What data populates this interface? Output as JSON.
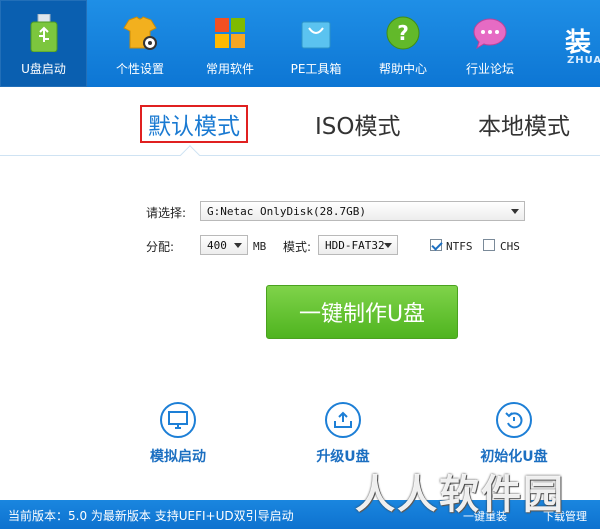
{
  "nav": {
    "items": [
      {
        "label": "U盘启动",
        "icon": "usb-icon"
      },
      {
        "label": "个性设置",
        "icon": "tshirt-gear-icon"
      },
      {
        "label": "常用软件",
        "icon": "windows-tiles-icon"
      },
      {
        "label": "PE工具箱",
        "icon": "shopping-bag-icon"
      },
      {
        "label": "帮助中心",
        "icon": "help-icon"
      },
      {
        "label": "行业论坛",
        "icon": "chat-bubble-icon"
      }
    ],
    "brand": "装",
    "brand_sub": "ZHUA"
  },
  "tabs": [
    "默认模式",
    "ISO模式",
    "本地模式"
  ],
  "form": {
    "select_label": "请选择:",
    "disk_value": "G:Netac OnlyDisk(28.7GB)",
    "alloc_label": "分配:",
    "alloc_value": "400",
    "alloc_unit": "MB",
    "mode_label": "模式:",
    "mode_value": "HDD-FAT32",
    "ntfs_label": "NTFS",
    "ntfs_checked": true,
    "chs_label": "CHS",
    "chs_checked": false
  },
  "make_button": "一键制作U盘",
  "tools": [
    {
      "label": "模拟启动",
      "icon": "monitor-icon"
    },
    {
      "label": "升级U盘",
      "icon": "upload-icon"
    },
    {
      "label": "初始化U盘",
      "icon": "reset-icon"
    }
  ],
  "status": {
    "text": "当前版本：5.0 为最新版本 支持UEFI+UD双引导启动",
    "right1": "一键重装",
    "right2": "下载管理"
  },
  "watermark": "人人软件园",
  "colors": {
    "accent": "#1a7ad2",
    "green": "#5cbf2a",
    "tab_highlight": "#e02020"
  }
}
